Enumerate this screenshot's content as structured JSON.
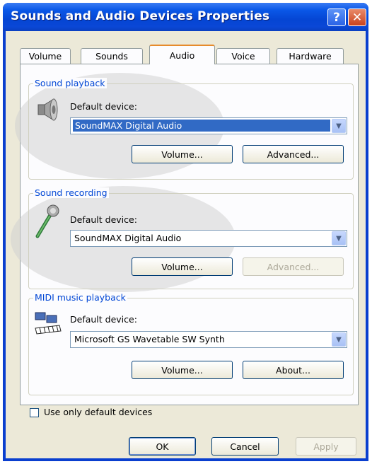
{
  "window": {
    "title": "Sounds and Audio Devices Properties"
  },
  "titlebar": {
    "help_label": "?",
    "close_label": "✕"
  },
  "tabs": [
    {
      "label": "Volume"
    },
    {
      "label": "Sounds"
    },
    {
      "label": "Audio"
    },
    {
      "label": "Voice"
    },
    {
      "label": "Hardware"
    }
  ],
  "playback": {
    "legend": "Sound playback",
    "device_label": "Default device:",
    "device_value": "SoundMAX Digital Audio",
    "volume_label": "Volume...",
    "advanced_label": "Advanced..."
  },
  "recording": {
    "legend": "Sound recording",
    "device_label": "Default device:",
    "device_value": "SoundMAX Digital Audio",
    "volume_label": "Volume...",
    "advanced_label": "Advanced..."
  },
  "midi": {
    "legend": "MIDI music playback",
    "device_label": "Default device:",
    "device_value": "Microsoft GS Wavetable SW Synth",
    "volume_label": "Volume...",
    "about_label": "About..."
  },
  "options": {
    "use_default_label": "Use only default devices"
  },
  "footer": {
    "ok_label": "OK",
    "cancel_label": "Cancel",
    "apply_label": "Apply"
  },
  "colors": {
    "titlebar": "#0545d3",
    "selection": "#316ac5",
    "legend": "#0046d5",
    "active_tab_accent": "#e68b2c"
  },
  "icons": {
    "playback": "speaker-icon",
    "recording": "microphone-icon",
    "midi": "midi-keyboard-icon"
  }
}
